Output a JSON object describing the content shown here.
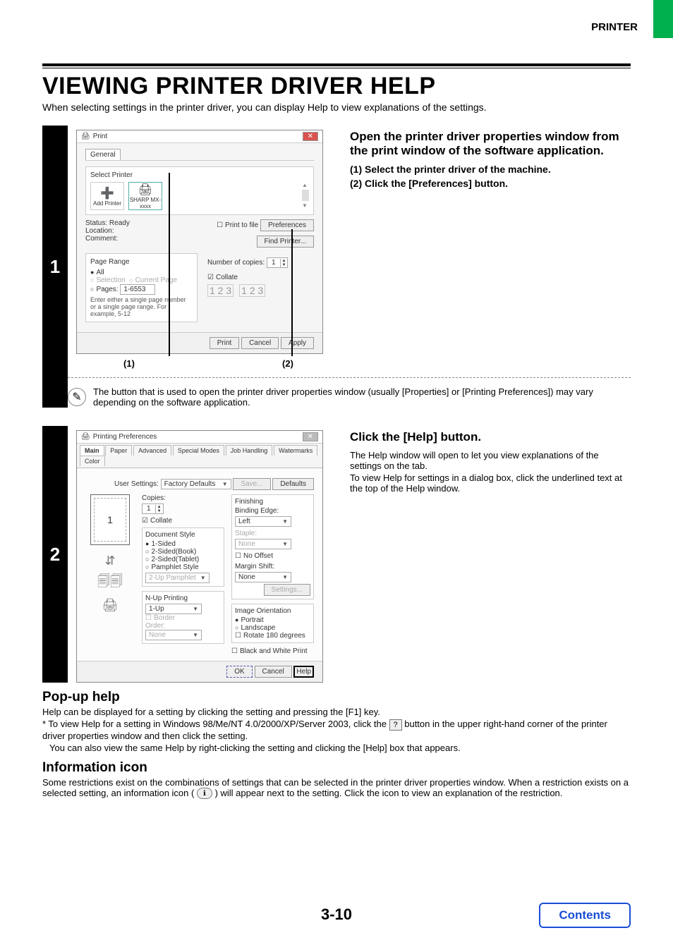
{
  "header": {
    "right": "PRINTER"
  },
  "title": "VIEWING PRINTER DRIVER HELP",
  "subtitle": "When selecting settings in the printer driver, you can display Help to view explanations of the settings.",
  "step1": {
    "num": "1",
    "title": "Open the printer driver properties window from the print window of the software application.",
    "sub1": "(1)  Select the printer driver of the machine.",
    "sub2": "(2)  Click the [Preferences] button.",
    "callout1": "(1)",
    "callout2": "(2)",
    "dialog": {
      "title": "Print",
      "tab": "General",
      "selectPrinter": "Select Printer",
      "addPrinter": "Add Printer",
      "printerName": "SHARP MX-xxxx",
      "statusLabel": "Status:",
      "statusValue": "Ready",
      "locationLabel": "Location:",
      "commentLabel": "Comment:",
      "printToFile": "Print to file",
      "preferences": "Preferences",
      "findPrinter": "Find Printer...",
      "pageRange": "Page Range",
      "all": "All",
      "selection": "Selection",
      "currentPage": "Current Page",
      "pages": "Pages:",
      "pagesValue": "1-6553",
      "pageHint": "Enter either a single page number or a single page range.  For example, 5-12",
      "copiesLabel": "Number of copies:",
      "copiesValue": "1",
      "collate": "Collate",
      "print": "Print",
      "cancel": "Cancel",
      "apply": "Apply"
    },
    "note": "The button that is used to open the printer driver properties window (usually [Properties] or [Printing Preferences]) may vary depending on the software application."
  },
  "step2": {
    "num": "2",
    "title": "Click the [Help] button.",
    "para1": "The Help window will open to let you view explanations of the settings on the tab.",
    "para2": "To view Help for settings in a dialog box, click the underlined text at the top of the Help window.",
    "dialog": {
      "title": "Printing Preferences",
      "tabs": [
        "Main",
        "Paper",
        "Advanced",
        "Special Modes",
        "Job Handling",
        "Watermarks",
        "Color"
      ],
      "userSettings": "User Settings:",
      "factoryDefaults": "Factory Defaults",
      "save": "Save...",
      "defaults": "Defaults",
      "copies": "Copies:",
      "copiesValue": "1",
      "collate": "Collate",
      "docStyle": "Document Style",
      "oneSided": "1-Sided",
      "twoSidedBook": "2-Sided(Book)",
      "twoSidedTablet": "2-Sided(Tablet)",
      "pamphlet": "Pamphlet Style",
      "twoUpPamphlet": "2-Up Pamphlet",
      "nup": "N-Up Printing",
      "oneUp": "1-Up",
      "border": "Border",
      "order": "Order:",
      "none": "None",
      "finishing": "Finishing",
      "bindingEdge": "Binding Edge:",
      "left": "Left",
      "staple": "Staple:",
      "noOffset": "No Offset",
      "marginShift": "Margin Shift:",
      "settings": "Settings...",
      "orientation": "Image Orientation",
      "portrait": "Portrait",
      "landscape": "Landscape",
      "rotate": "Rotate 180 degrees",
      "bw": "Black and White Print",
      "ok": "OK",
      "cancel": "Cancel",
      "help": "Help",
      "pageNum": "1"
    }
  },
  "popup": {
    "heading": "Pop-up help",
    "line1": "Help can be displayed for a setting by clicking the setting and pressing the [F1] key.",
    "line2a": "* To view Help for a setting in Windows 98/Me/NT 4.0/2000/XP/Server 2003, click the ",
    "line2b": " button in the upper right-hand corner of the printer driver properties window and then click the setting.",
    "line3": "You can also view the same Help by right-clicking the setting and clicking the [Help] box that appears.",
    "q": "?"
  },
  "info": {
    "heading": "Information icon",
    "line1": "Some restrictions exist on the combinations of settings that can be selected in the printer driver properties window. When a restriction exists on a selected setting, an information icon ( ",
    "line1b": " ) will appear next to the setting. Click the icon to view an explanation of the restriction.",
    "i": "ℹ"
  },
  "pageNumber": "3-10",
  "contents": "Contents"
}
